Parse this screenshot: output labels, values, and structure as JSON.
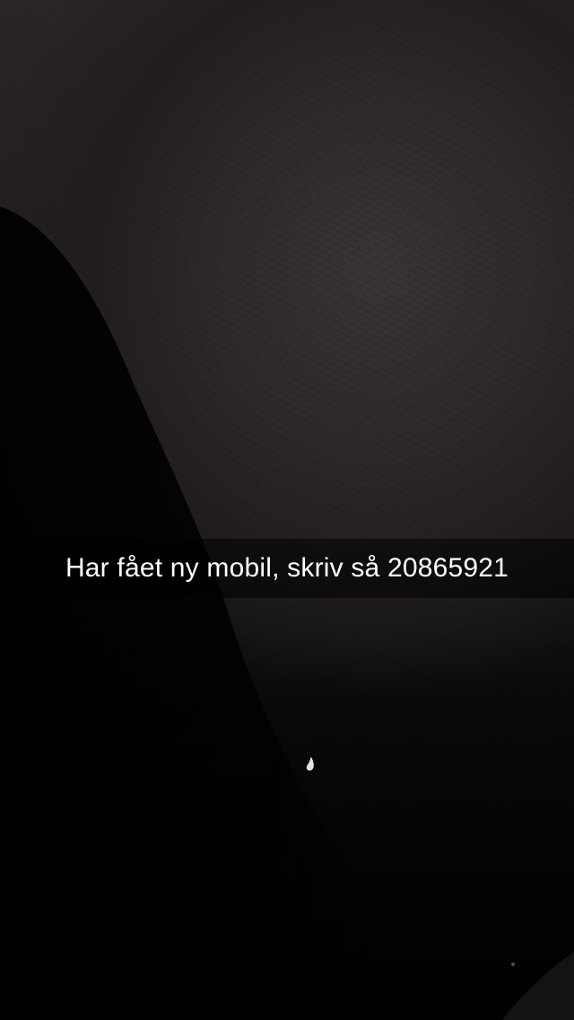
{
  "snap": {
    "caption": "Har fået ny mobil, skriv så 20865921"
  },
  "icons": {
    "speck": "light-speck-icon"
  },
  "colors": {
    "background": "#050404",
    "surface": "#2e2929",
    "caption_bar": "rgba(0,0,0,0.55)",
    "caption_text": "#ffffff"
  }
}
